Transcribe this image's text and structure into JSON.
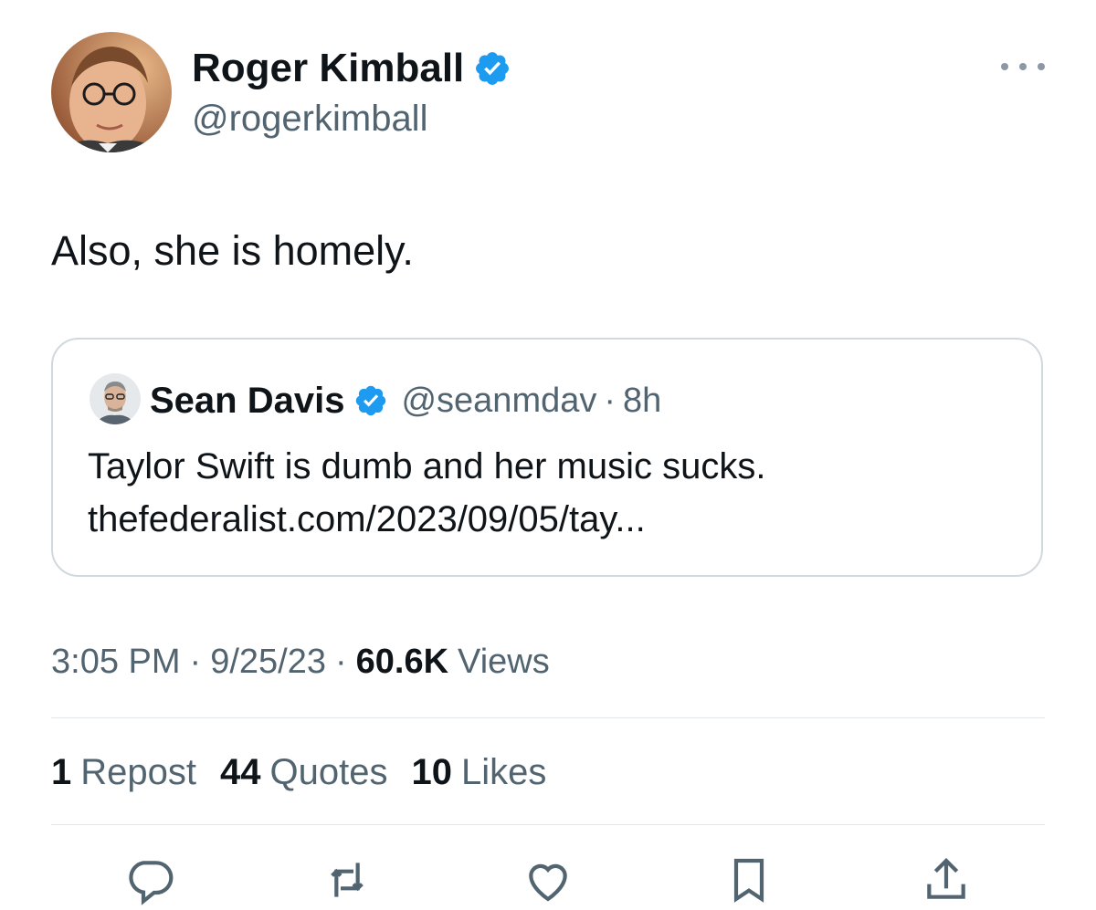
{
  "tweet": {
    "author": {
      "display_name": "Roger Kimball",
      "handle": "@rogerkimball",
      "verified": true
    },
    "text": "Also, she is homely.",
    "quoted": {
      "author": {
        "display_name": "Sean Davis",
        "handle": "@seanmdav",
        "verified": true
      },
      "separator": "·",
      "time_ago": "8h",
      "text": "Taylor Swift is dumb and her music sucks.",
      "link": "thefederalist.com/2023/09/05/tay..."
    },
    "meta": {
      "time": "3:05 PM",
      "separator": "·",
      "date": "9/25/23",
      "views_count": "60.6K",
      "views_label": "Views"
    },
    "stats": {
      "reposts_count": "1",
      "reposts_label": "Repost",
      "quotes_count": "44",
      "quotes_label": "Quotes",
      "likes_count": "10",
      "likes_label": "Likes"
    }
  },
  "actions": [
    {
      "icon": "reply-icon"
    },
    {
      "icon": "repost-icon"
    },
    {
      "icon": "like-icon"
    },
    {
      "icon": "bookmark-icon"
    },
    {
      "icon": "share-icon"
    }
  ],
  "colors": {
    "verified": "#1d9bf0",
    "secondary_text": "#536471",
    "primary_text": "#0f1419",
    "border": "#cfd9de"
  }
}
